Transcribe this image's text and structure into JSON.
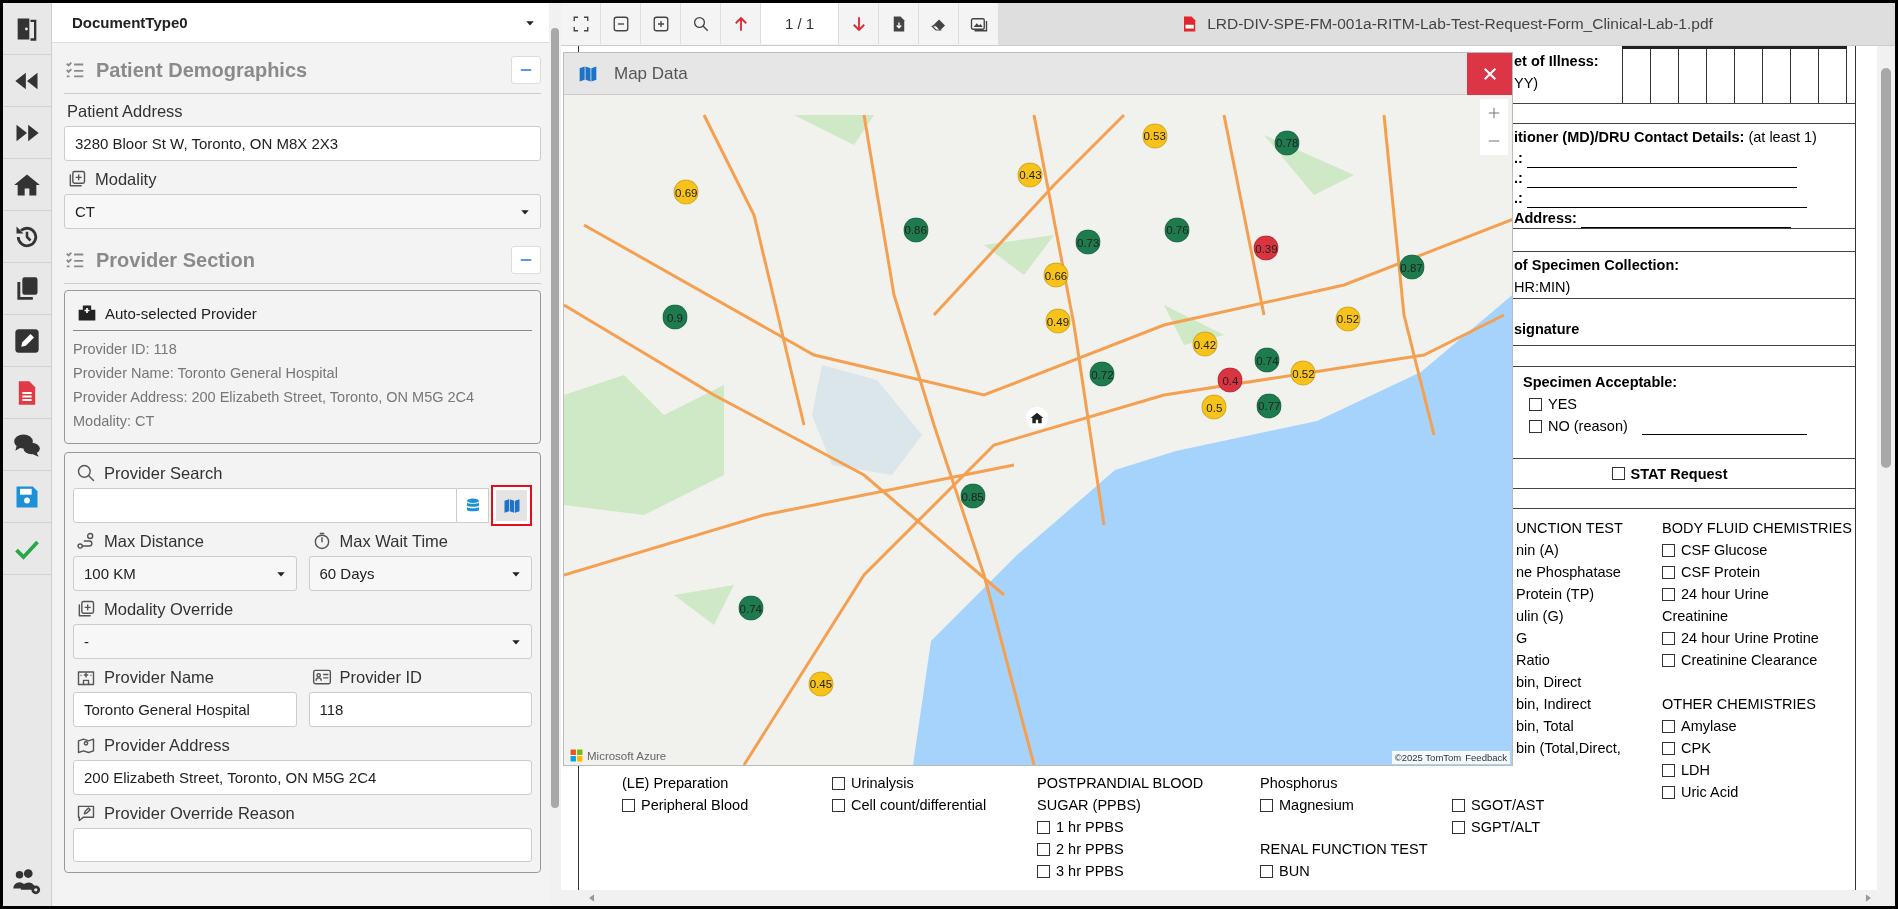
{
  "form": {
    "document_type": "DocumentType0",
    "patient_demographics": {
      "title": "Patient Demographics",
      "fields": [
        {
          "label": "Patient Address",
          "kind": "text",
          "value": "3280 Bloor St W, Toronto, ON M8X 2X3"
        },
        {
          "label": "Modality",
          "kind": "select",
          "value": "CT"
        }
      ]
    },
    "provider_section": {
      "title": "Provider Section",
      "auto_selected": {
        "title": "Auto-selected Provider",
        "lines": [
          "Provider ID: 118",
          "Provider Name: Toronto General Hospital",
          "Provider Address: 200 Elizabeth Street, Toronto, ON M5G 2C4",
          "Modality: CT"
        ]
      },
      "search": {
        "label": "Provider Search"
      },
      "rows": [
        [
          {
            "label": "Max Distance",
            "kind": "select",
            "value": "100 KM"
          },
          {
            "label": "Max Wait Time",
            "kind": "select",
            "value": "60 Days"
          }
        ],
        [
          {
            "label": "Modality Override",
            "kind": "select",
            "value": "-"
          }
        ],
        [
          {
            "label": "Provider Name",
            "kind": "text",
            "value": "Toronto General Hospital"
          },
          {
            "label": "Provider ID",
            "kind": "text",
            "value": "118"
          }
        ],
        [
          {
            "label": "Provider Address",
            "kind": "text",
            "value": "200 Elizabeth Street, Toronto, ON M5G 2C4"
          }
        ],
        [
          {
            "label": "Provider Override Reason",
            "kind": "textarea"
          }
        ]
      ]
    }
  },
  "pdf": {
    "page": "1 / 1",
    "file_name": "LRD-DIV-SPE-FM-001a-RITM-Lab-Test-Request-Form_Clinical-Lab-1.pdf",
    "document": {
      "onset": [
        "et of Illness:",
        "YY)"
      ],
      "contact": {
        "heading": "**itioner (MD)/DRU Contact Details:** (at least 1)",
        "lines": [
          ".:",
          ".:",
          ".:",
          "Address:"
        ]
      },
      "collection": [
        "of Specimen Collection:",
        "HR:MIN)"
      ],
      "signature": "signature",
      "acceptable": {
        "title": "Specimen Acceptable:",
        "options": [
          {
            "label": "YES",
            "checked": false
          },
          {
            "label": "NO (reason)",
            "checked": false
          }
        ]
      },
      "stat": {
        "label": "STAT Request",
        "checked": false
      },
      "fragment_column": [
        "UNCTION TEST",
        "nin (A)",
        "ne Phosphatase",
        "Protein (TP)",
        "ulin (G)",
        "G",
        "Ratio",
        "bin, Direct",
        "bin, Indirect",
        "bin, Total",
        "bin (Total,Direct,"
      ],
      "right_column": [
        {
          "kind": "heading",
          "text": "BODY FLUID CHEMISTRIES"
        },
        {
          "kind": "check",
          "text": "CSF Glucose",
          "checked": false
        },
        {
          "kind": "check",
          "text": "CSF Protein",
          "checked": false
        },
        {
          "kind": "check",
          "text": "24 hour Urine",
          "checked": false
        },
        {
          "kind": "text",
          "text": "Creatinine"
        },
        {
          "kind": "check",
          "text": "24 hour Urine Protine",
          "checked": false
        },
        {
          "kind": "check",
          "text": "Creatinine Clearance",
          "checked": false
        },
        {
          "kind": "heading",
          "text": "OTHER CHEMISTRIES"
        },
        {
          "kind": "check",
          "text": "Amylase",
          "checked": false
        },
        {
          "kind": "check",
          "text": "CPK",
          "checked": false
        },
        {
          "kind": "check",
          "text": "LDH",
          "checked": false
        },
        {
          "kind": "check",
          "text": "Uric Acid",
          "checked": false
        }
      ],
      "bottom_columns": [
        [
          {
            "kind": "text",
            "text": "(LE) Preparation"
          },
          {
            "kind": "check",
            "text": "Peripheral Blood",
            "checked": false
          }
        ],
        [
          {
            "kind": "check",
            "text": "Urinalysis",
            "checked": false
          },
          {
            "kind": "check",
            "text": "Cell count/differential",
            "checked": false
          }
        ],
        [
          {
            "kind": "text",
            "text": "POSTPRANDIAL BLOOD"
          },
          {
            "kind": "text",
            "text": "SUGAR (PPBS)"
          },
          {
            "kind": "check",
            "text": "1 hr PPBS",
            "checked": false
          },
          {
            "kind": "check",
            "text": "2 hr PPBS",
            "checked": false
          },
          {
            "kind": "check",
            "text": "3 hr PPBS",
            "checked": false
          }
        ],
        [
          {
            "kind": "text",
            "text": "Phosphorus"
          },
          {
            "kind": "check",
            "text": "Magnesium",
            "checked": false
          },
          {
            "kind": "heading",
            "text": "RENAL FUNCTION TEST"
          },
          {
            "kind": "check",
            "text": "BUN",
            "checked": false
          }
        ],
        [
          {
            "kind": "check",
            "text": "SGOT/AST",
            "checked": false
          },
          {
            "kind": "check",
            "text": "SGPT/ALT",
            "checked": false
          }
        ]
      ]
    }
  },
  "map": {
    "title": "Map Data",
    "markers": [
      {
        "label": "0.53",
        "color": "#f7c31a"
      },
      {
        "label": "0.78",
        "color": "#1e7b4e"
      },
      {
        "label": "0.43",
        "color": "#f7c31a"
      },
      {
        "label": "0.69",
        "color": "#f7c31a"
      },
      {
        "label": "0.86",
        "color": "#1e7b4e"
      },
      {
        "label": "0.73",
        "color": "#1e7b4e"
      },
      {
        "label": "0.76",
        "color": "#1e7b4e"
      },
      {
        "label": "0.39",
        "color": "#d9343f"
      },
      {
        "label": "0.87",
        "color": "#1e7b4e"
      },
      {
        "label": "0.66",
        "color": "#f7c31a"
      },
      {
        "label": "0.9",
        "color": "#1e7b4e"
      },
      {
        "label": "0.49",
        "color": "#f7c31a"
      },
      {
        "label": "0.52",
        "color": "#f7c31a"
      },
      {
        "label": "0.42",
        "color": "#f7c31a"
      },
      {
        "label": "0.74",
        "color": "#1e7b4e"
      },
      {
        "label": "0.52",
        "color": "#f7c31a"
      },
      {
        "label": "0.72",
        "color": "#1e7b4e"
      },
      {
        "label": "0.4",
        "color": "#d9343f"
      },
      {
        "label": "0.5",
        "color": "#f7c31a"
      },
      {
        "label": "0.77",
        "color": "#1e7b4e"
      },
      {
        "label": "0.85",
        "color": "#1e7b4e"
      },
      {
        "label": "0.74",
        "color": "#1e7b4e"
      },
      {
        "label": "0.45",
        "color": "#f7c31a"
      }
    ],
    "brand": "Microsoft Azure",
    "copyright": "©2025 TomTom",
    "feedback": "Feedback"
  }
}
